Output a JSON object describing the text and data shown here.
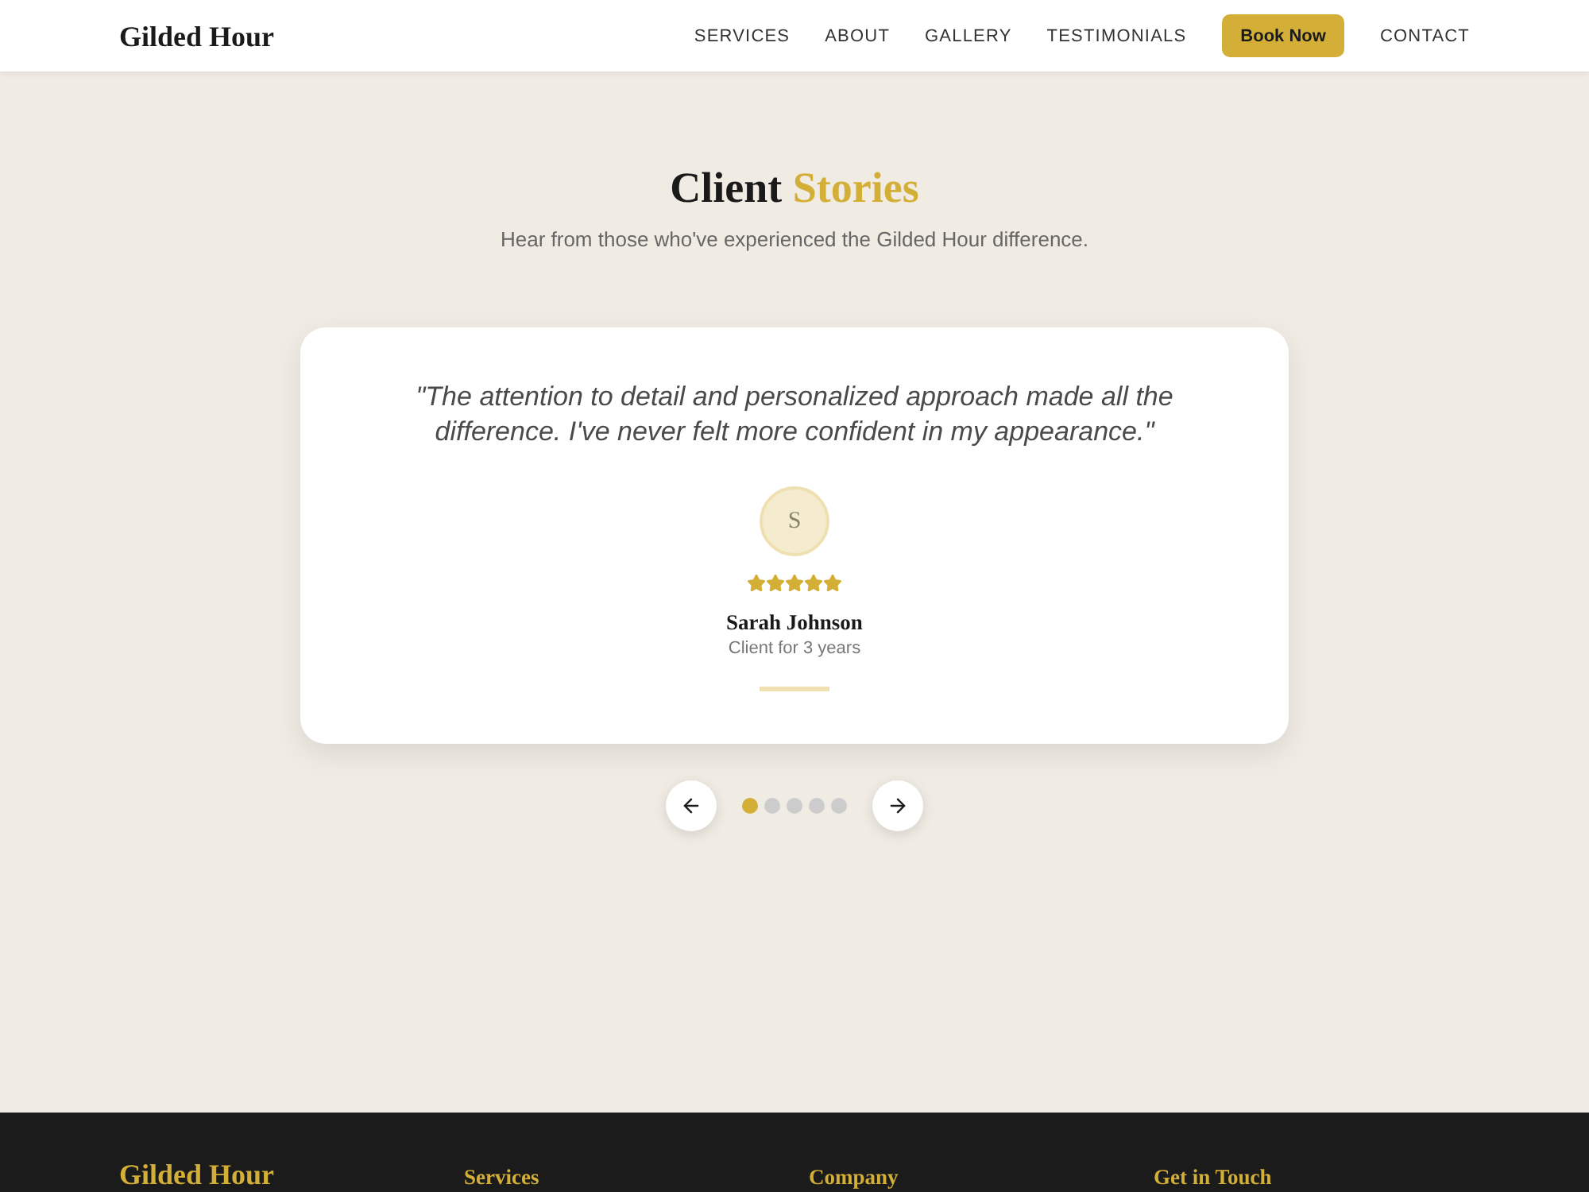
{
  "header": {
    "logo": "Gilded Hour",
    "nav": [
      {
        "label": "SERVICES",
        "kind": "link"
      },
      {
        "label": "ABOUT",
        "kind": "link"
      },
      {
        "label": "GALLERY",
        "kind": "link"
      },
      {
        "label": "TESTIMONIALS",
        "kind": "link"
      },
      {
        "label": "Book Now",
        "kind": "button"
      },
      {
        "label": "CONTACT",
        "kind": "link"
      }
    ]
  },
  "section": {
    "title": [
      {
        "text": "Client",
        "accent": false
      },
      {
        "text": "Stories",
        "accent": true
      }
    ],
    "subtitle": "Hear from those who've experienced the Gilded Hour difference."
  },
  "testimonial": {
    "quote": "\"The attention to detail and personalized approach made all the difference. I've never felt more confident in my appearance.\"",
    "initial": "S",
    "stars": 5,
    "name": "Sarah Johnson",
    "detail": "Client for 3 years"
  },
  "carousel": {
    "dots": [
      {
        "selected": true
      },
      {
        "selected": false
      },
      {
        "selected": false
      },
      {
        "selected": false
      },
      {
        "selected": false
      }
    ]
  },
  "footer": {
    "logo": "Gilded Hour",
    "columns": [
      {
        "heading": "Services"
      },
      {
        "heading": "Company"
      },
      {
        "heading": "Get in Touch"
      }
    ]
  }
}
